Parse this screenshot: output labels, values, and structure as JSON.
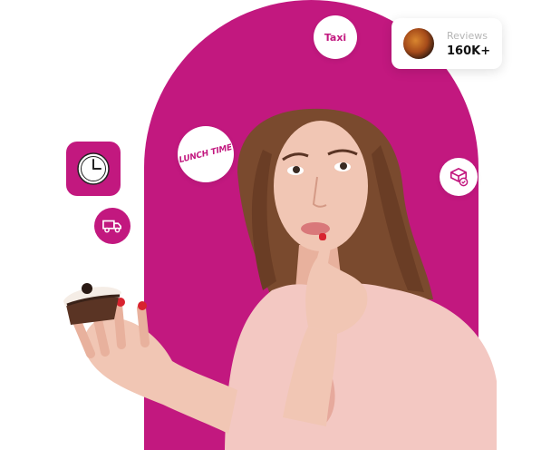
{
  "brand": {
    "accent_color": "#c2187f",
    "skin_color": "#f1c6b4",
    "top_color": "#f3c8c2",
    "hair_color": "#7a4a2e"
  },
  "badges": {
    "taxi_label": "Taxi",
    "lunch_label": "LUNCH TIME"
  },
  "reviews_card": {
    "label": "Reviews",
    "value": "160K+",
    "thumb_icon": "food-plate-icon"
  },
  "icons": {
    "clock": "clock-icon",
    "truck": "delivery-truck-icon",
    "package": "package-check-icon",
    "cupcake": "chocolate-cupcake-icon"
  }
}
